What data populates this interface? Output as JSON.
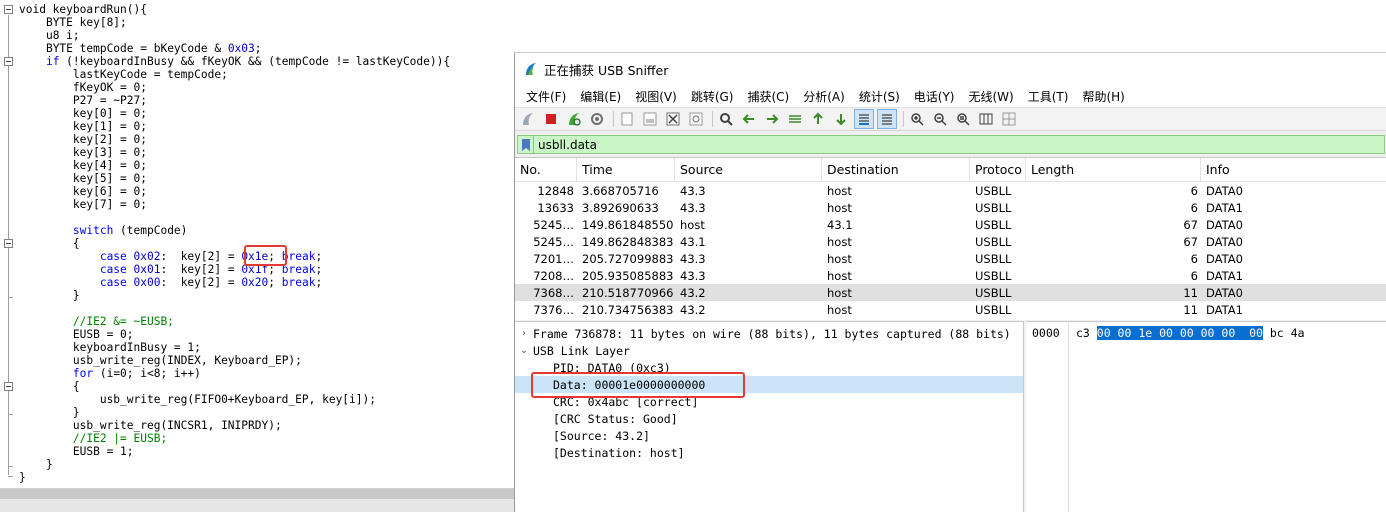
{
  "editor": {
    "lines": [
      {
        "indent": 0,
        "parts": [
          [
            "t",
            "void keyboardRun(){"
          ]
        ]
      },
      {
        "indent": 4,
        "parts": [
          [
            "t",
            "BYTE key[8];"
          ]
        ]
      },
      {
        "indent": 4,
        "parts": [
          [
            "t",
            "u8 i;"
          ]
        ]
      },
      {
        "indent": 4,
        "parts": [
          [
            "t",
            "BYTE tempCode = bKeyCode & "
          ],
          [
            "h",
            "0x03"
          ],
          [
            "t",
            ";"
          ]
        ]
      },
      {
        "indent": 4,
        "parts": [
          [
            "k",
            "if"
          ],
          [
            "t",
            " (!keyboardInBusy && fKeyOK && (tempCode != lastKeyCode)){"
          ]
        ]
      },
      {
        "indent": 8,
        "parts": [
          [
            "t",
            "lastKeyCode = tempCode;"
          ]
        ]
      },
      {
        "indent": 8,
        "parts": [
          [
            "t",
            "fKeyOK = 0;"
          ]
        ]
      },
      {
        "indent": 8,
        "parts": [
          [
            "t",
            "P27 = ~P27;"
          ]
        ]
      },
      {
        "indent": 8,
        "parts": [
          [
            "t",
            "key[0] = 0;"
          ]
        ]
      },
      {
        "indent": 8,
        "parts": [
          [
            "t",
            "key[1] = 0;"
          ]
        ]
      },
      {
        "indent": 8,
        "parts": [
          [
            "t",
            "key[2] = 0;"
          ]
        ]
      },
      {
        "indent": 8,
        "parts": [
          [
            "t",
            "key[3] = 0;"
          ]
        ]
      },
      {
        "indent": 8,
        "parts": [
          [
            "t",
            "key[4] = 0;"
          ]
        ]
      },
      {
        "indent": 8,
        "parts": [
          [
            "t",
            "key[5] = 0;"
          ]
        ]
      },
      {
        "indent": 8,
        "parts": [
          [
            "t",
            "key[6] = 0;"
          ]
        ]
      },
      {
        "indent": 8,
        "parts": [
          [
            "t",
            "key[7] = 0;"
          ]
        ]
      },
      {
        "indent": 0,
        "parts": []
      },
      {
        "indent": 8,
        "parts": [
          [
            "k",
            "switch"
          ],
          [
            "t",
            " (tempCode)"
          ]
        ]
      },
      {
        "indent": 8,
        "parts": [
          [
            "t",
            "{"
          ]
        ]
      },
      {
        "indent": 12,
        "parts": [
          [
            "k",
            "case"
          ],
          [
            "t",
            " "
          ],
          [
            "h",
            "0x02"
          ],
          [
            "t",
            ":  key[2] = "
          ],
          [
            "h",
            "0x1e"
          ],
          [
            "t",
            "; "
          ],
          [
            "k",
            "break"
          ],
          [
            "t",
            ";"
          ]
        ]
      },
      {
        "indent": 12,
        "parts": [
          [
            "k",
            "case"
          ],
          [
            "t",
            " "
          ],
          [
            "h",
            "0x01"
          ],
          [
            "t",
            ":  key[2] = "
          ],
          [
            "h",
            "0x1f"
          ],
          [
            "t",
            "; "
          ],
          [
            "k",
            "break"
          ],
          [
            "t",
            ";"
          ]
        ]
      },
      {
        "indent": 12,
        "parts": [
          [
            "k",
            "case"
          ],
          [
            "t",
            " "
          ],
          [
            "h",
            "0x00"
          ],
          [
            "t",
            ":  key[2] = "
          ],
          [
            "h",
            "0x20"
          ],
          [
            "t",
            "; "
          ],
          [
            "k",
            "break"
          ],
          [
            "t",
            ";"
          ]
        ]
      },
      {
        "indent": 8,
        "parts": [
          [
            "t",
            "}"
          ]
        ]
      },
      {
        "indent": 0,
        "parts": []
      },
      {
        "indent": 8,
        "parts": [
          [
            "c",
            "//IE2 &= ~EUSB;"
          ]
        ]
      },
      {
        "indent": 8,
        "parts": [
          [
            "t",
            "EUSB = 0;"
          ]
        ]
      },
      {
        "indent": 8,
        "parts": [
          [
            "t",
            "keyboardInBusy = 1;"
          ]
        ]
      },
      {
        "indent": 8,
        "parts": [
          [
            "t",
            "usb_write_reg(INDEX, Keyboard_EP);"
          ]
        ]
      },
      {
        "indent": 8,
        "parts": [
          [
            "k",
            "for"
          ],
          [
            "t",
            " (i=0; i<8; i++)"
          ]
        ]
      },
      {
        "indent": 8,
        "parts": [
          [
            "t",
            "{"
          ]
        ]
      },
      {
        "indent": 12,
        "parts": [
          [
            "t",
            "usb_write_reg(FIFO0+Keyboard_EP, key[i]);"
          ]
        ]
      },
      {
        "indent": 8,
        "parts": [
          [
            "t",
            "}"
          ]
        ]
      },
      {
        "indent": 8,
        "parts": [
          [
            "t",
            "usb_write_reg(INCSR1, INIPRDY);"
          ]
        ]
      },
      {
        "indent": 8,
        "parts": [
          [
            "c",
            "//IE2 |= EUSB;"
          ]
        ]
      },
      {
        "indent": 8,
        "parts": [
          [
            "t",
            "EUSB = 1;"
          ]
        ]
      },
      {
        "indent": 4,
        "parts": [
          [
            "t",
            "}"
          ]
        ]
      },
      {
        "indent": 0,
        "parts": [
          [
            "t",
            "}"
          ]
        ]
      }
    ]
  },
  "wireshark": {
    "title": "正在捕获 USB Sniffer",
    "menu": [
      "文件(F)",
      "编辑(E)",
      "视图(V)",
      "跳转(G)",
      "捕获(C)",
      "分析(A)",
      "统计(S)",
      "电话(Y)",
      "无线(W)",
      "工具(T)",
      "帮助(H)"
    ],
    "filter": "usbll.data",
    "columns": [
      "No.",
      "Time",
      "Source",
      "Destination",
      "Protoco",
      "Length",
      "Info"
    ],
    "packets": [
      {
        "no": "12848",
        "time": "3.668705716",
        "src": "43.3",
        "dst": "host",
        "proto": "USBLL",
        "len": "6",
        "info": "DATA0",
        "selected": false
      },
      {
        "no": "13633",
        "time": "3.892690633",
        "src": "43.3",
        "dst": "host",
        "proto": "USBLL",
        "len": "6",
        "info": "DATA1",
        "selected": false
      },
      {
        "no": "5245…",
        "time": "149.861848550",
        "src": "host",
        "dst": "43.1",
        "proto": "USBLL",
        "len": "67",
        "info": "DATA0",
        "selected": false
      },
      {
        "no": "5245…",
        "time": "149.862848383",
        "src": "43.1",
        "dst": "host",
        "proto": "USBLL",
        "len": "67",
        "info": "DATA0",
        "selected": false
      },
      {
        "no": "7201…",
        "time": "205.727099883",
        "src": "43.3",
        "dst": "host",
        "proto": "USBLL",
        "len": "6",
        "info": "DATA0",
        "selected": false
      },
      {
        "no": "7208…",
        "time": "205.935085883",
        "src": "43.3",
        "dst": "host",
        "proto": "USBLL",
        "len": "6",
        "info": "DATA1",
        "selected": false
      },
      {
        "no": "7368…",
        "time": "210.518770966",
        "src": "43.2",
        "dst": "host",
        "proto": "USBLL",
        "len": "11",
        "info": "DATA0",
        "selected": true
      },
      {
        "no": "7376…",
        "time": "210.734756383",
        "src": "43.2",
        "dst": "host",
        "proto": "USBLL",
        "len": "11",
        "info": "DATA1",
        "selected": false
      }
    ],
    "details": [
      {
        "arrow": "›",
        "indent": 0,
        "text": "Frame 736878: 11 bytes on wire (88 bits), 11 bytes captured (88 bits)",
        "selected": false
      },
      {
        "arrow": "⌄",
        "indent": 0,
        "text": "USB Link Layer",
        "selected": false
      },
      {
        "arrow": "",
        "indent": 2,
        "text": "PID: DATA0 (0xc3)",
        "selected": false
      },
      {
        "arrow": "",
        "indent": 2,
        "text": "Data: 00001e0000000000",
        "selected": true
      },
      {
        "arrow": "",
        "indent": 2,
        "text": "CRC: 0x4abc [correct]",
        "selected": false
      },
      {
        "arrow": "",
        "indent": 2,
        "text": "[CRC Status: Good]",
        "selected": false
      },
      {
        "arrow": "",
        "indent": 2,
        "text": "[Source: 43.2]",
        "selected": false
      },
      {
        "arrow": "",
        "indent": 2,
        "text": "[Destination: host]",
        "selected": false
      }
    ],
    "bytes": {
      "offset": "0000",
      "prefix": "c3 ",
      "highlight": "00 00 1e 00 00 00 00  00",
      "suffix": " bc 4a"
    }
  },
  "colors": {
    "annotation": "#e53935",
    "filter_bg": "#c9f6c4",
    "selection": "#cce4f7",
    "bytes_highlight": "#0a6ed1"
  }
}
